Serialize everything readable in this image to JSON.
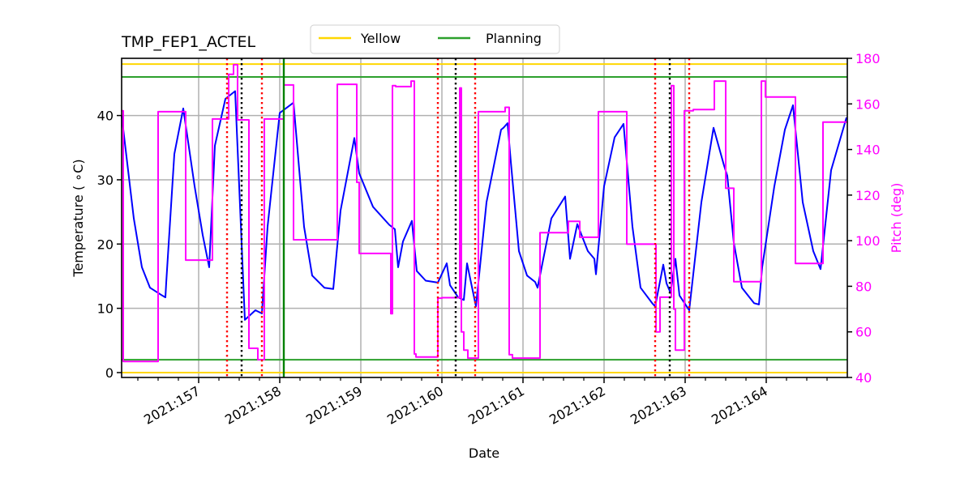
{
  "chart_data": {
    "type": "line",
    "title": "TMP_FEP1_ACTEL",
    "xlabel": "Date",
    "ylabel": "Temperature ($^\\circ$C)",
    "ylabel_display": "Temperature ( ∘C)",
    "y2label": "Pitch (deg)",
    "xlim": [
      156.05,
      165.0
    ],
    "ylim": [
      -0.76,
      48.9
    ],
    "y2lim": [
      40,
      180
    ],
    "grid": true,
    "legend_position": "top-center (above axes)",
    "x_ticks": [
      157,
      158,
      159,
      160,
      161,
      162,
      163,
      164
    ],
    "x_tick_labels": [
      "2021:157",
      "2021:158",
      "2021:159",
      "2021:160",
      "2021:161",
      "2021:162",
      "2021:163",
      "2021:164"
    ],
    "x_minor_step": 0.25,
    "y_ticks": [
      0,
      10,
      20,
      30,
      40
    ],
    "y_tick_labels": [
      "0",
      "10",
      "20",
      "30",
      "40"
    ],
    "y2_ticks": [
      40,
      60,
      80,
      100,
      120,
      140,
      160,
      180
    ],
    "y2_tick_labels": [
      "40",
      "60",
      "80",
      "100",
      "120",
      "140",
      "160",
      "180"
    ],
    "colors": {
      "temperature": "#0000ff",
      "pitch": "#ff00ff",
      "yellow_limit": "#ffd700",
      "planning_limit": "#2ca02c",
      "grid": "#b0b0b0",
      "red_marker": "#ff0000",
      "black_marker": "#000000",
      "green_marker": "#008000",
      "pitch_axis": "#ff00ff"
    },
    "legend": [
      {
        "label": "Yellow",
        "color": "#ffd700"
      },
      {
        "label": "Planning",
        "color": "#2ca02c"
      }
    ],
    "limit_lines": [
      {
        "name": "yellow-high",
        "value": 48.0,
        "color": "#ffd700",
        "legend": "Yellow"
      },
      {
        "name": "yellow-low",
        "value": 0.0,
        "color": "#ffd700",
        "legend": "Yellow"
      },
      {
        "name": "planning-high",
        "value": 46.0,
        "color": "#2ca02c",
        "legend": "Planning"
      },
      {
        "name": "planning-low",
        "value": 2.0,
        "color": "#2ca02c",
        "legend": "Planning"
      }
    ],
    "vertical_markers": [
      {
        "x": 157.35,
        "color": "#ff0000",
        "style": "dotted"
      },
      {
        "x": 157.53,
        "color": "#000000",
        "style": "dotted"
      },
      {
        "x": 157.78,
        "color": "#ff0000",
        "style": "dotted"
      },
      {
        "x": 158.05,
        "color": "#008000",
        "style": "solid"
      },
      {
        "x": 159.95,
        "color": "#ff0000",
        "style": "dotted"
      },
      {
        "x": 160.17,
        "color": "#000000",
        "style": "dotted"
      },
      {
        "x": 160.41,
        "color": "#ff0000",
        "style": "dotted"
      },
      {
        "x": 162.63,
        "color": "#ff0000",
        "style": "dotted"
      },
      {
        "x": 162.81,
        "color": "#000000",
        "style": "dotted"
      },
      {
        "x": 163.05,
        "color": "#ff0000",
        "style": "dotted"
      }
    ],
    "series": [
      {
        "name": "TMP_FEP1_ACTEL",
        "axis": "left",
        "color": "#0000ff",
        "x": [
          156.05,
          156.2,
          156.3,
          156.4,
          156.55,
          156.59,
          156.6,
          156.7,
          156.81,
          156.95,
          157.05,
          157.13,
          157.2,
          157.33,
          157.45,
          157.57,
          157.7,
          157.78,
          157.85,
          158.0,
          158.17,
          158.3,
          158.4,
          158.55,
          158.66,
          158.75,
          158.92,
          158.98,
          159.15,
          159.35,
          159.42,
          159.46,
          159.52,
          159.63,
          159.69,
          159.8,
          159.95,
          160.06,
          160.1,
          160.2,
          160.27,
          160.31,
          160.42,
          160.55,
          160.73,
          160.76,
          160.81,
          160.85,
          160.95,
          161.05,
          161.15,
          161.18,
          161.35,
          161.52,
          161.58,
          161.67,
          161.8,
          161.88,
          161.9,
          162.0,
          162.13,
          162.24,
          162.35,
          162.45,
          162.6,
          162.63,
          162.73,
          162.77,
          162.82,
          162.88,
          162.93,
          163.05,
          163.2,
          163.35,
          163.48,
          163.52,
          163.6,
          163.7,
          163.85,
          163.91,
          163.95,
          164.1,
          164.23,
          164.33,
          164.45,
          164.58,
          164.67,
          164.8,
          164.99
        ],
        "values": [
          40,
          24,
          16.4,
          13.2,
          12.0,
          11.7,
          14,
          34,
          41.1,
          29,
          21.4,
          16.4,
          35.3,
          42.6,
          43.8,
          8.2,
          9.7,
          9.2,
          22.7,
          40.4,
          42,
          22.7,
          15.1,
          13.2,
          13,
          25.2,
          36.5,
          31,
          25.8,
          23,
          22.3,
          16.4,
          20.4,
          23.6,
          15.8,
          14.3,
          14,
          17,
          13.6,
          11.7,
          11.3,
          17,
          10.3,
          26.5,
          37.8,
          38.1,
          38.8,
          32.8,
          18.9,
          15.1,
          14.1,
          13.2,
          24,
          27.4,
          17.7,
          23.1,
          18.9,
          17.7,
          15.3,
          29,
          36.6,
          38.7,
          22.7,
          13.2,
          10.7,
          10.3,
          16.8,
          13.9,
          12.4,
          17.7,
          12,
          9.7,
          26.5,
          38.1,
          32.2,
          30.6,
          20.2,
          13.2,
          10.8,
          10.6,
          16.4,
          29,
          37.8,
          41.6,
          26.5,
          18.9,
          16.1,
          31.5,
          39.7
        ]
      },
      {
        "name": "Pitch",
        "axis": "right",
        "color": "#ff00ff",
        "step": true,
        "x": [
          156.05,
          156.07,
          156.07,
          156.5,
          156.5,
          156.84,
          156.84,
          157.17,
          157.17,
          157.37,
          157.37,
          157.43,
          157.43,
          157.48,
          157.48,
          157.62,
          157.62,
          157.73,
          157.73,
          157.81,
          157.81,
          158.05,
          158.05,
          158.17,
          158.17,
          158.71,
          158.71,
          158.95,
          158.95,
          158.98,
          158.98,
          159.37,
          159.37,
          159.39,
          159.39,
          159.43,
          159.43,
          159.62,
          159.62,
          159.66,
          159.66,
          159.68,
          159.68,
          159.95,
          159.95,
          160.0,
          160.0,
          160.22,
          160.22,
          160.24,
          160.24,
          160.27,
          160.27,
          160.32,
          160.32,
          160.45,
          160.45,
          160.78,
          160.78,
          160.83,
          160.83,
          160.87,
          160.87,
          161.21,
          161.21,
          161.56,
          161.56,
          161.7,
          161.7,
          161.93,
          161.93,
          162.28,
          162.28,
          162.64,
          162.64,
          162.69,
          162.69,
          162.83,
          162.83,
          162.86,
          162.86,
          162.88,
          162.88,
          162.99,
          162.99,
          163.1,
          163.1,
          163.36,
          163.36,
          163.5,
          163.5,
          163.6,
          163.6,
          163.94,
          163.94,
          163.99,
          163.99,
          164.36,
          164.36,
          164.7,
          164.7,
          165.0
        ],
        "values": [
          157,
          157,
          47,
          47,
          156.6,
          156.6,
          91.5,
          91.5,
          153.4,
          153.4,
          173,
          173,
          177.2,
          177.2,
          153,
          153,
          52.8,
          52.8,
          47.8,
          47.8,
          153.4,
          153.4,
          168.3,
          168.3,
          100.4,
          100.4,
          168.6,
          168.6,
          125.6,
          125.6,
          94.4,
          94.4,
          68,
          68,
          168,
          168,
          167.6,
          167.6,
          170,
          170,
          50.3,
          50.3,
          49,
          49,
          74.8,
          74.8,
          75,
          75,
          167,
          167,
          60,
          60,
          52,
          52,
          48.5,
          48.5,
          156.6,
          156.6,
          158.5,
          158.5,
          50,
          50,
          48.5,
          48.5,
          103.5,
          103.5,
          108.5,
          108.5,
          101.5,
          101.5,
          156.6,
          156.6,
          98.5,
          98.5,
          60,
          60,
          75.2,
          75.2,
          168,
          168,
          70,
          70,
          52,
          52,
          157,
          157,
          157.5,
          157.5,
          170,
          170,
          123,
          123,
          82,
          82,
          170,
          170,
          163,
          163,
          90,
          90,
          152,
          152,
          157,
          157
        ]
      }
    ]
  }
}
